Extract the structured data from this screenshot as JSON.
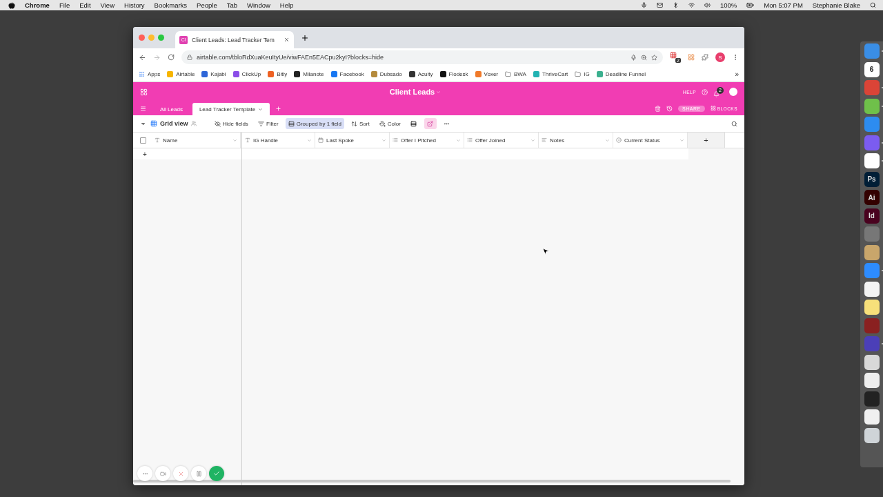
{
  "menubar": {
    "app": "Chrome",
    "menus": [
      "File",
      "Edit",
      "View",
      "History",
      "Bookmarks",
      "People",
      "Tab",
      "Window",
      "Help"
    ],
    "battery": "100%",
    "clock": "Mon 5:07 PM",
    "user": "Stephanie Blake"
  },
  "browser": {
    "tab": {
      "favicon": "Cl",
      "title": "Client Leads: Lead Tracker Tem"
    },
    "url": "airtable.com/tbloRdXuaKeuItyUe/viwFAEn5EACpu2kyI?blocks=hide",
    "extension_badge": "2",
    "profile": "S",
    "bookmarks": [
      {
        "kind": "apps",
        "label": "Apps"
      },
      {
        "kind": "site",
        "label": "Airtable",
        "color": "#f7b500"
      },
      {
        "kind": "site",
        "label": "Kajabi",
        "color": "#2e66d8"
      },
      {
        "kind": "site",
        "label": "ClickUp",
        "color": "#8b4de8"
      },
      {
        "kind": "site",
        "label": "Bitly",
        "color": "#ee6123"
      },
      {
        "kind": "site",
        "label": "Milanote",
        "color": "#222222"
      },
      {
        "kind": "site",
        "label": "Facebook",
        "color": "#1877f2"
      },
      {
        "kind": "site",
        "label": "Dubsado",
        "color": "#b58a3c"
      },
      {
        "kind": "site",
        "label": "Acuity",
        "color": "#333333"
      },
      {
        "kind": "site",
        "label": "Flodesk",
        "color": "#111111"
      },
      {
        "kind": "site",
        "label": "Voxer",
        "color": "#f07a2a"
      },
      {
        "kind": "folder",
        "label": "BWA"
      },
      {
        "kind": "site",
        "label": "ThriveCart",
        "color": "#22b3b3"
      },
      {
        "kind": "folder",
        "label": "IG"
      },
      {
        "kind": "site",
        "label": "Deadline Funnel",
        "color": "#3bb08f"
      }
    ],
    "more": "»"
  },
  "airtable": {
    "base_title": "Client Leads",
    "help": "HELP",
    "notifications": "2",
    "share": "SHARE",
    "blocks": "BLOCKS",
    "tables": [
      {
        "label": "All Leads",
        "selected": false
      },
      {
        "label": "Lead Tracker Template",
        "selected": true
      }
    ],
    "view": "Grid view",
    "toolbar": [
      {
        "kind": "hide",
        "label": "Hide fields",
        "active": false
      },
      {
        "kind": "filter",
        "label": "Filter",
        "active": false
      },
      {
        "kind": "group",
        "label": "Grouped by 1 field",
        "active": true
      },
      {
        "kind": "sort",
        "label": "Sort",
        "active": false
      },
      {
        "kind": "color",
        "label": "Color",
        "active": false
      }
    ],
    "columns": [
      {
        "kind": "text",
        "label": "Name"
      },
      {
        "kind": "text",
        "label": "IG Handle"
      },
      {
        "kind": "date",
        "label": "Last Spoke"
      },
      {
        "kind": "multi",
        "label": "Offer I Pitched"
      },
      {
        "kind": "multi",
        "label": "Offer Joined"
      },
      {
        "kind": "longtext",
        "label": "Notes"
      },
      {
        "kind": "status",
        "label": "Current Status"
      }
    ],
    "add_column": "+",
    "add_row": "+",
    "select_all_checked": false
  },
  "dock": [
    {
      "color": "#3a8ee6",
      "running": true
    },
    {
      "color": "#ffffff",
      "label": "6",
      "running": false
    },
    {
      "color": "#db4437",
      "running": true
    },
    {
      "color": "#6fc04a",
      "running": true
    },
    {
      "color": "#2d8cf0",
      "running": false
    },
    {
      "color": "#7b5cf0",
      "running": true
    },
    {
      "color": "#ffffff",
      "running": true
    },
    {
      "color": "#001e36",
      "label": "Ps",
      "running": false
    },
    {
      "color": "#330000",
      "label": "Ai",
      "running": false
    },
    {
      "color": "#49021f",
      "label": "Id",
      "running": false
    },
    {
      "color": "#777777",
      "running": false
    },
    {
      "color": "#c9a66b",
      "running": false
    },
    {
      "color": "#2d8cff",
      "running": true
    },
    {
      "color": "#f3f3f3",
      "running": false
    },
    {
      "color": "#f7e07a",
      "running": false
    },
    {
      "color": "#8a2020",
      "running": false
    },
    {
      "color": "#4b3fb8",
      "running": true
    },
    {
      "color": "#d8d8d8",
      "running": false
    },
    {
      "color": "#eeeeee",
      "running": false
    },
    {
      "color": "#222222",
      "running": false
    },
    {
      "color": "#f0f0f0",
      "running": false
    },
    {
      "color": "#cfd4d8",
      "running": false
    }
  ]
}
